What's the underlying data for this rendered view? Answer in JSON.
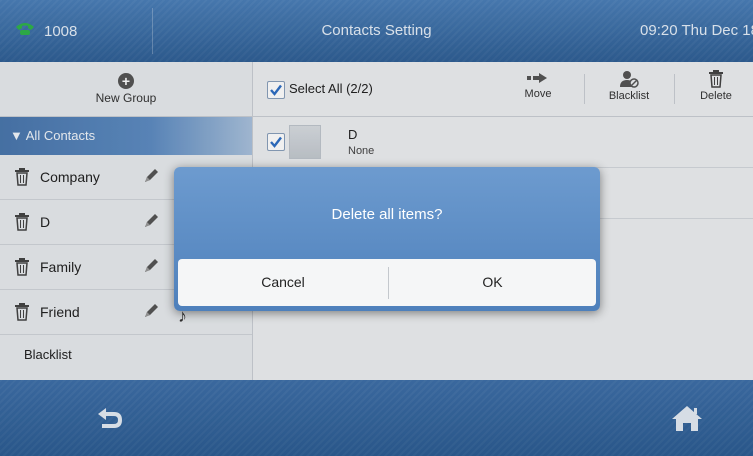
{
  "status_bar": {
    "extension": "1008",
    "title": "Contacts Setting",
    "clock": "09:20 Thu Dec 18"
  },
  "sidebar": {
    "new_group_label": "New Group",
    "all_contacts_label": "▼ All Contacts",
    "groups": [
      {
        "label": "Company"
      },
      {
        "label": "D"
      },
      {
        "label": "Family"
      },
      {
        "label": "Friend"
      }
    ],
    "blacklist_label": "Blacklist"
  },
  "main": {
    "select_all_label": "Select All (2/2)",
    "toolbar": {
      "move_label": "Move",
      "blacklist_label": "Blacklist",
      "delete_label": "Delete"
    },
    "contacts": [
      {
        "name": "D",
        "group": "None",
        "checked": true
      }
    ]
  },
  "dialog": {
    "message": "Delete all items?",
    "cancel_label": "Cancel",
    "ok_label": "OK"
  },
  "colors": {
    "accent_blue": "#4a77ad",
    "checkbox_tick": "#2f6fc4",
    "phone_green": "#2fb34a"
  },
  "icons": [
    "phone-icon",
    "plus-icon",
    "trash-icon",
    "pencil-icon",
    "move-icon",
    "blacklist-user-icon",
    "back-icon",
    "home-icon"
  ]
}
